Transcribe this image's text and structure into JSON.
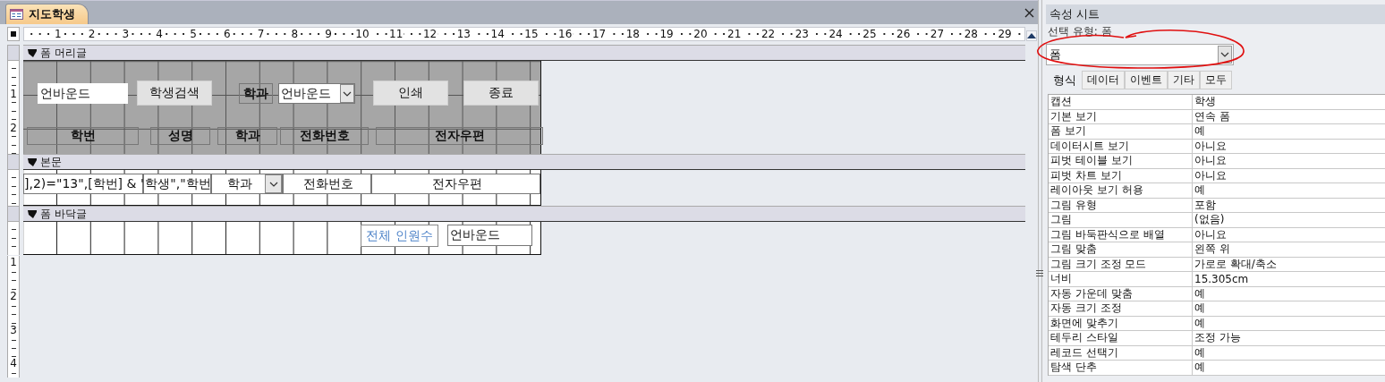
{
  "document_tab": {
    "title": "지도학생",
    "selected": true
  },
  "ruler": {
    "marks": [
      "1",
      "2",
      "3",
      "4",
      "5",
      "6",
      "7",
      "8",
      "9",
      "10",
      "11",
      "12",
      "13",
      "14",
      "15",
      "16",
      "17",
      "18",
      "19",
      "20",
      "21",
      "22",
      "23",
      "24",
      "25",
      "26",
      "27",
      "28",
      "29"
    ]
  },
  "sections": [
    {
      "title": "폼 머리글",
      "kind": "header",
      "ruler_marks": [
        "1",
        "2"
      ],
      "controls": [
        {
          "kind": "textbox",
          "text": "언바운드"
        },
        {
          "kind": "button",
          "text": "학생검색"
        },
        {
          "kind": "heading",
          "text": "학과"
        },
        {
          "kind": "combo",
          "text": "언바운드"
        },
        {
          "kind": "button",
          "text": "인쇄"
        },
        {
          "kind": "button",
          "text": "종료"
        },
        {
          "kind": "heading",
          "text": "학번"
        },
        {
          "kind": "heading",
          "text": "성명"
        },
        {
          "kind": "heading",
          "text": "학과"
        },
        {
          "kind": "heading",
          "text": "전화번호"
        },
        {
          "kind": "heading",
          "text": "전자우편"
        }
      ]
    },
    {
      "title": "본문",
      "kind": "detail",
      "controls": [
        {
          "kind": "textbox",
          "text": "],2)=\"13\",[학번] & \""
        },
        {
          "kind": "textbox",
          "text": "학생\",\"학번"
        },
        {
          "kind": "combo",
          "text": "학과"
        },
        {
          "kind": "textbox",
          "text": "전화번호"
        },
        {
          "kind": "textbox",
          "text": "전자우편"
        }
      ]
    },
    {
      "title": "폼 바닥글",
      "kind": "footer",
      "controls": [
        {
          "kind": "label",
          "text": "전체 인원수"
        },
        {
          "kind": "textbox",
          "text": "언바운드"
        }
      ]
    }
  ],
  "below_ruler_marks": [
    "1",
    "2",
    "3",
    "4"
  ],
  "property_sheet": {
    "title": "속성 시트",
    "selection_type": "선택 유형:  폼",
    "object_combo": "폼",
    "tabs": [
      {
        "label": "형식",
        "selected": true
      },
      {
        "label": "데이터",
        "selected": false
      },
      {
        "label": "이벤트",
        "selected": false
      },
      {
        "label": "기타",
        "selected": false
      },
      {
        "label": "모두",
        "selected": false
      }
    ],
    "properties": [
      {
        "name": "캡션",
        "value": "학생"
      },
      {
        "name": "기본 보기",
        "value": "연속 폼"
      },
      {
        "name": "폼 보기",
        "value": "예"
      },
      {
        "name": "데이터시트 보기",
        "value": "아니요"
      },
      {
        "name": "피벗 테이블 보기",
        "value": "아니요"
      },
      {
        "name": "피벗 차트 보기",
        "value": "아니요"
      },
      {
        "name": "레이아웃 보기 허용",
        "value": "예"
      },
      {
        "name": "그림 유형",
        "value": "포함"
      },
      {
        "name": "그림",
        "value": "(없음)"
      },
      {
        "name": "그림 바둑판식으로 배열",
        "value": "아니요"
      },
      {
        "name": "그림 맞춤",
        "value": "왼쪽 위"
      },
      {
        "name": "그림 크기 조정 모드",
        "value": "가로로 확대/축소"
      },
      {
        "name": "너비",
        "value": "15.305cm"
      },
      {
        "name": "자동 가운데 맞춤",
        "value": "예"
      },
      {
        "name": "자동 크기 조정",
        "value": "예"
      },
      {
        "name": "화면에 맞추기",
        "value": "예"
      },
      {
        "name": "테두리 스타일",
        "value": "조정 가능"
      },
      {
        "name": "레코드 선택기",
        "value": "예"
      },
      {
        "name": "탐색 단추",
        "value": "예"
      }
    ]
  }
}
